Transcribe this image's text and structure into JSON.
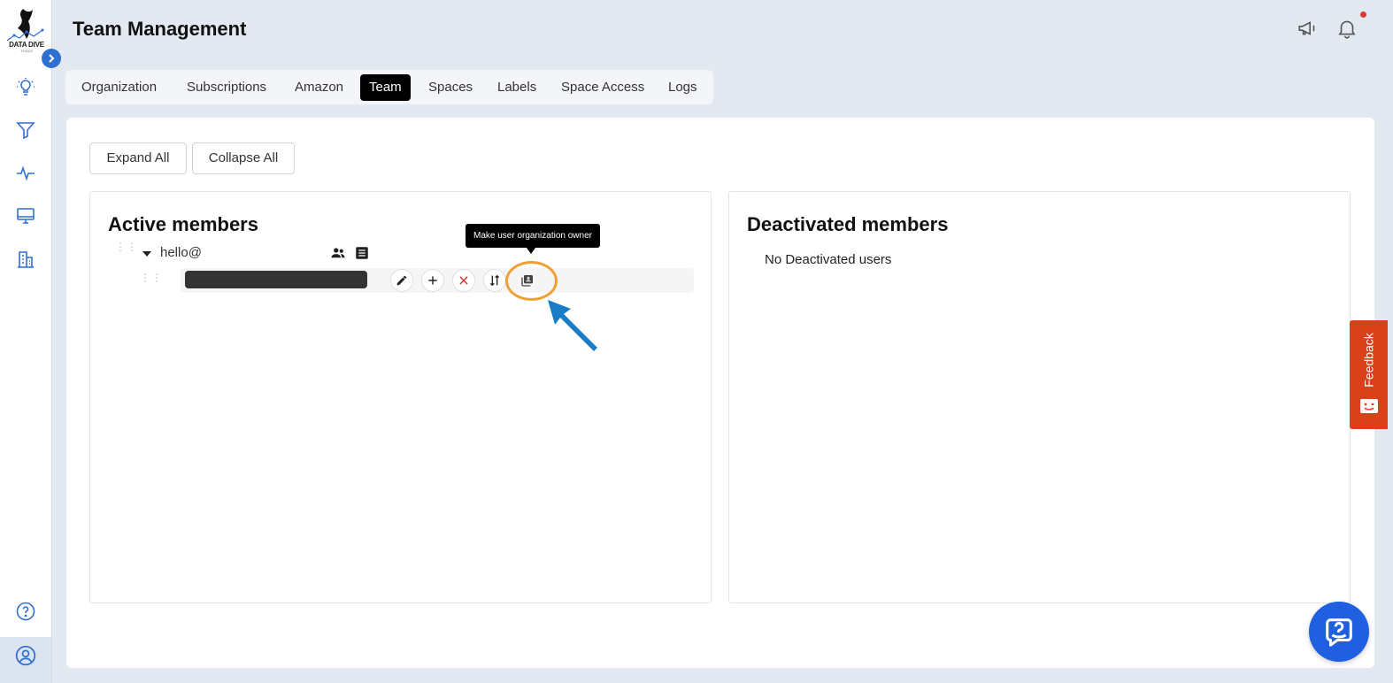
{
  "app": {
    "logo_text": "DATA DIVE",
    "logo_sub": "TOOLS"
  },
  "header": {
    "title": "Team Management"
  },
  "tabs": [
    {
      "label": "Organization",
      "active": false
    },
    {
      "label": "Subscriptions",
      "active": false
    },
    {
      "label": "Amazon",
      "active": false
    },
    {
      "label": "Team",
      "active": true
    },
    {
      "label": "Spaces",
      "active": false
    },
    {
      "label": "Labels",
      "active": false
    },
    {
      "label": "Space Access",
      "active": false
    },
    {
      "label": "Logs",
      "active": false
    }
  ],
  "toolbar": {
    "expand_all": "Expand All",
    "collapse_all": "Collapse All"
  },
  "active_members": {
    "title": "Active members",
    "member": {
      "name": "hello@"
    },
    "tooltip": "Make user organization owner"
  },
  "deactivated_members": {
    "title": "Deactivated members",
    "empty_text": "No Deactivated users"
  },
  "feedback": {
    "label": "Feedback"
  },
  "colors": {
    "accent": "#2f6fd1",
    "feedback": "#d9411b",
    "highlight": "#f0a033",
    "arrow": "#1a7cc4",
    "help": "#1f5fe0"
  }
}
